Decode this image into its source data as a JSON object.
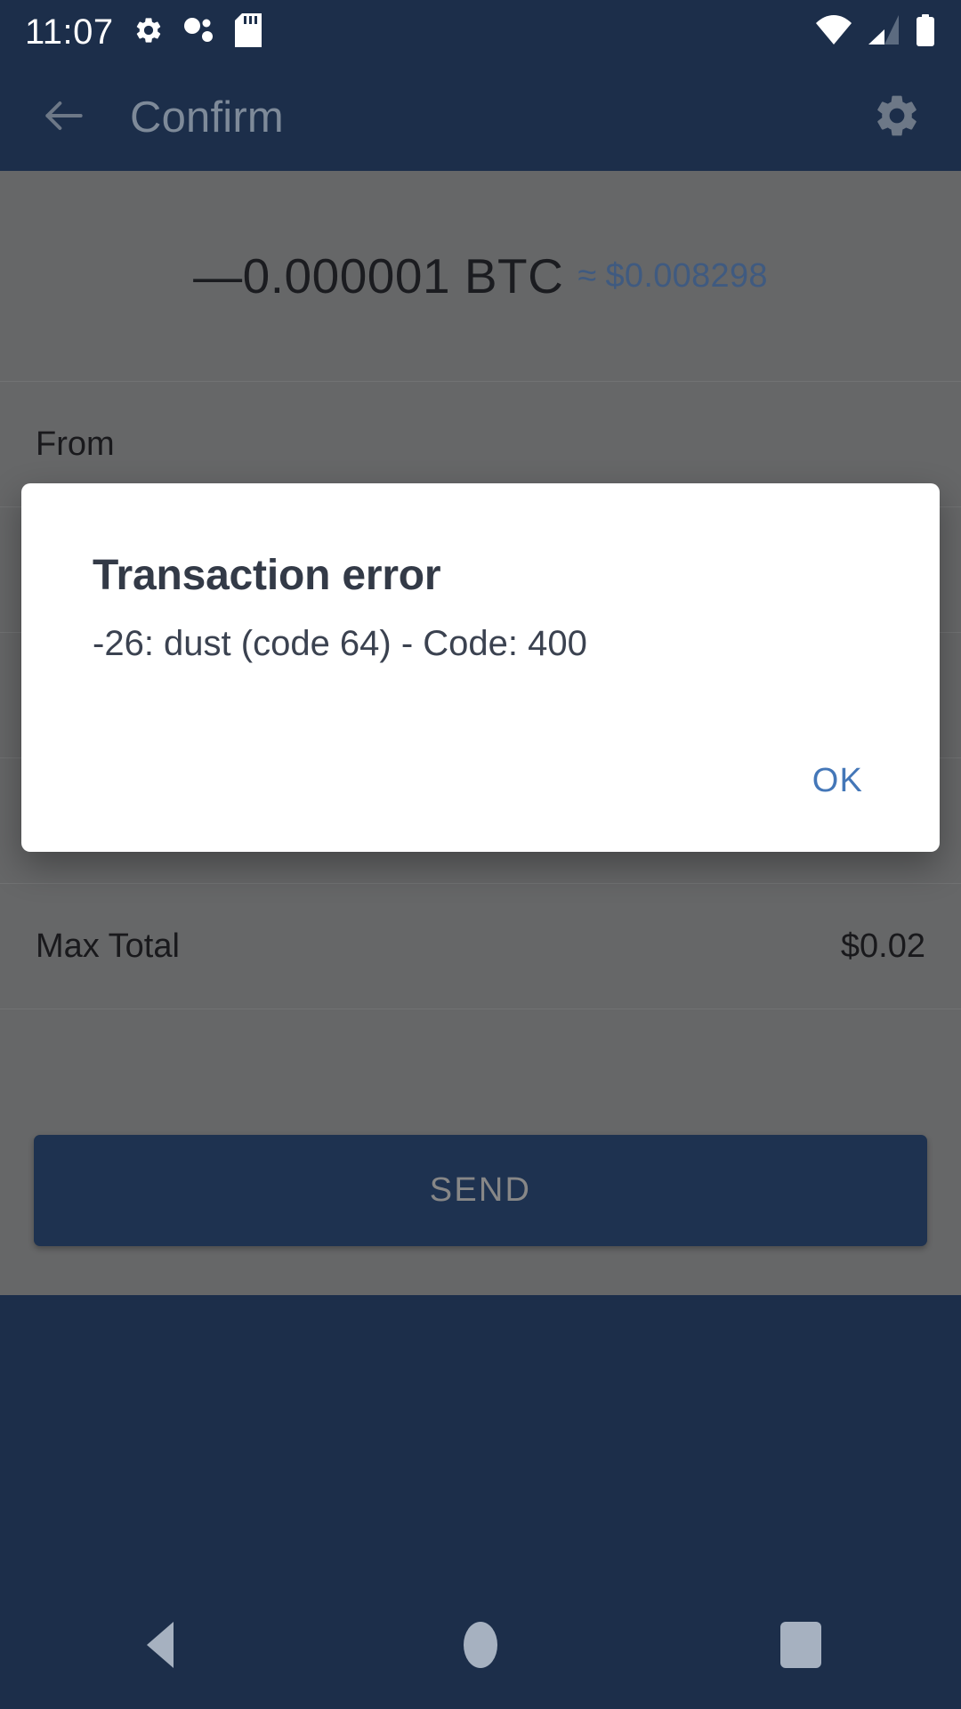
{
  "status_bar": {
    "time": "11:07",
    "left_icons": [
      "gear-icon",
      "bubbles-icon",
      "sd-card-icon"
    ],
    "right_icons": [
      "wifi-icon",
      "cellular-signal-icon",
      "battery-icon"
    ]
  },
  "app_bar": {
    "title": "Confirm",
    "back_icon": "arrow-left-icon",
    "settings_icon": "gear-icon",
    "background_color": "#1c2e4a",
    "title_color": "#7e8a99"
  },
  "transaction": {
    "amount_btc": "—0.000001 BTC",
    "approx_symbol": "≈",
    "amount_fiat": "$0.008298",
    "fiat_color": "#3f5a80",
    "rows": [
      {
        "label": "From",
        "value": ""
      },
      {
        "label": "Max Total",
        "value": "$0.02"
      }
    ]
  },
  "send_button": {
    "label": "SEND",
    "background_color": "#1e3250",
    "label_color": "#878787"
  },
  "dialog": {
    "title": "Transaction error",
    "message": "-26: dust (code 64) - Code: 400",
    "ok_label": "OK",
    "ok_color": "#4477b8",
    "background_color": "#ffffff"
  },
  "nav_bar": {
    "background_color": "#1c2e4a",
    "items": [
      {
        "name": "back",
        "icon": "triangle-left-icon"
      },
      {
        "name": "home",
        "icon": "circle-icon"
      },
      {
        "name": "recents",
        "icon": "square-icon"
      }
    ]
  },
  "scrim": {
    "color": "#666768"
  }
}
